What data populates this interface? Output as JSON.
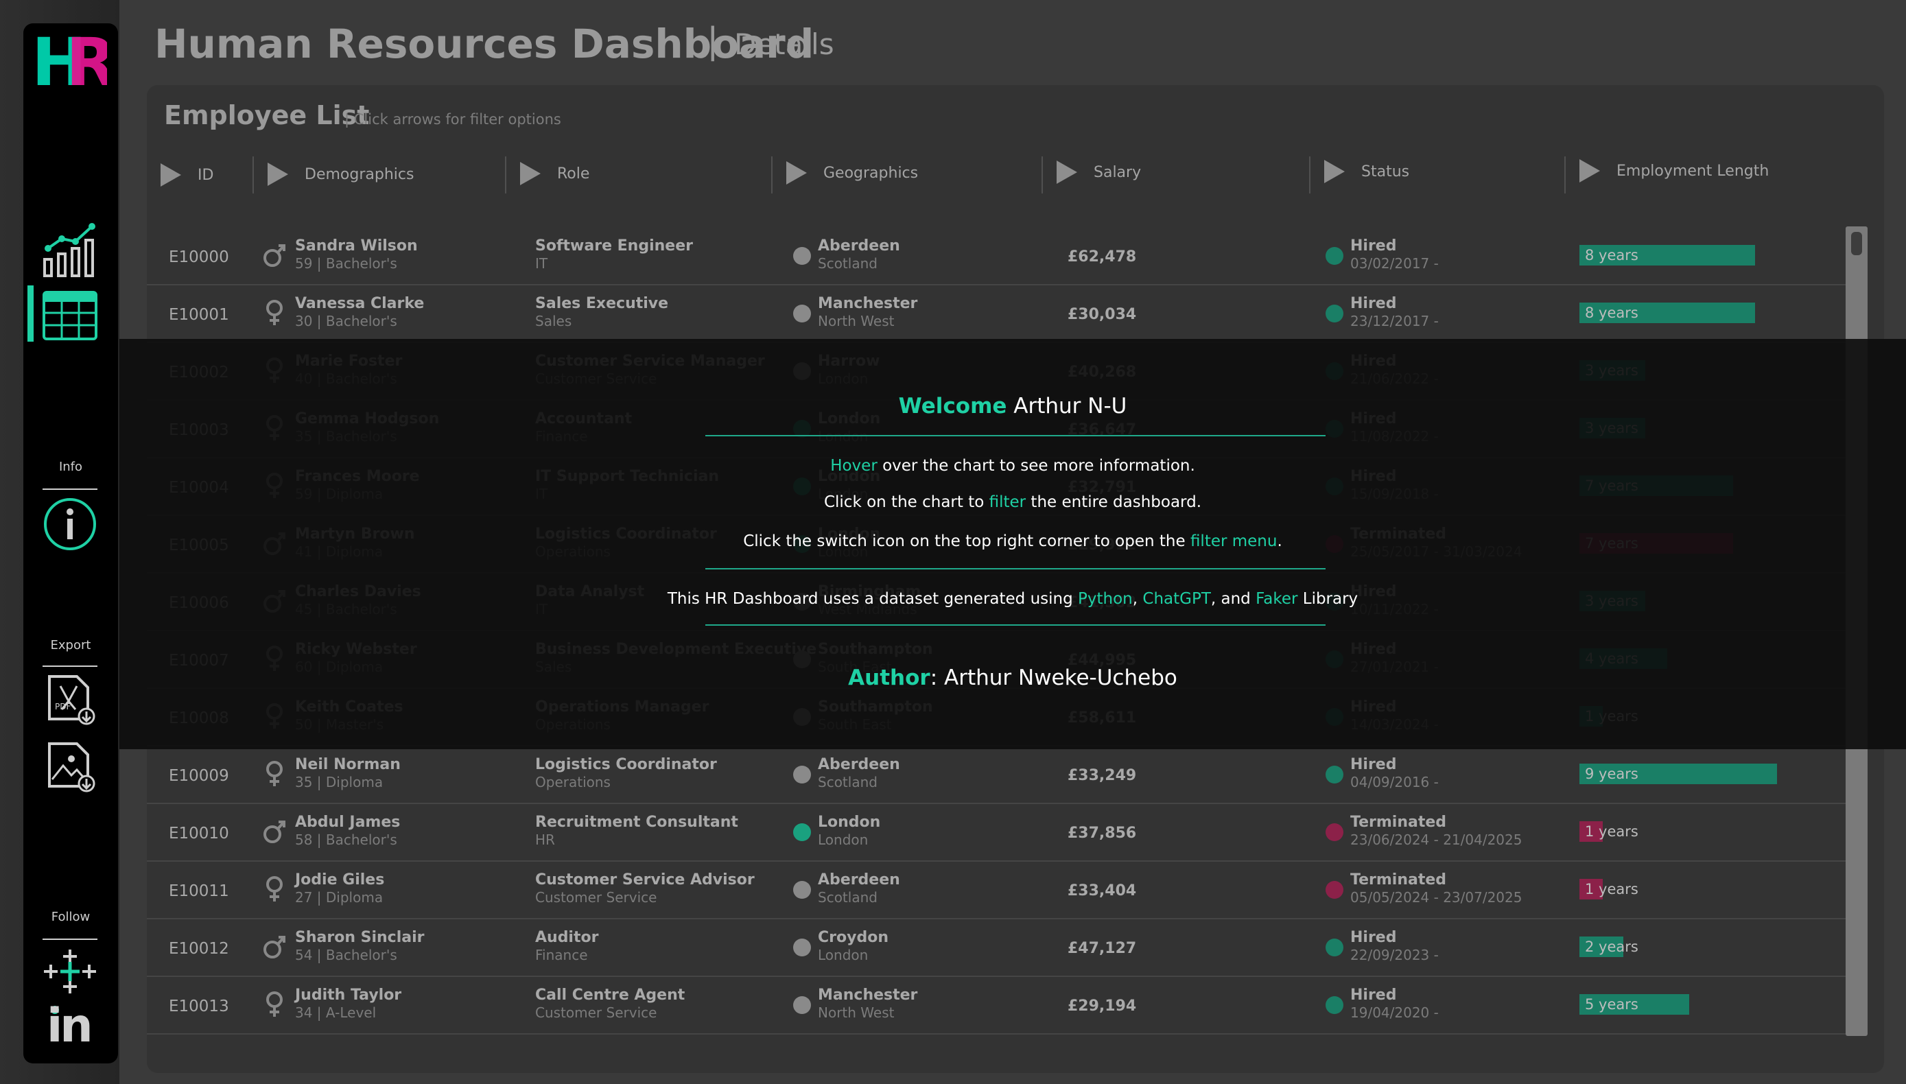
{
  "app": {
    "title": "Human Resources Dashboard",
    "separator": "|",
    "subtitle": "Details"
  },
  "sidebar": {
    "logo_letters": "HR",
    "info_label": "Info",
    "export_label": "Export",
    "follow_label": "Follow",
    "icons": [
      "line-chart-icon",
      "table-icon",
      "info-icon",
      "pdf-download-icon",
      "image-download-icon",
      "tableau-icon",
      "linkedin-icon"
    ],
    "pdf_badge": "PDF",
    "linkedin_text": "in"
  },
  "panel": {
    "title": "Employee List",
    "hint": "| Click arrows for filter options"
  },
  "columns": [
    "ID",
    "Demographics",
    "Role",
    "Geographics",
    "Salary",
    "Status",
    "Employment Length"
  ],
  "colors": {
    "accent": "#1fd1a5",
    "hired": "#1a7f66",
    "terminated": "#8c2149",
    "location_teal": "#1aa17f",
    "location_grey": "#8a8a8a",
    "logo_teal": "#00c9a7",
    "logo_pink": "#e0168f"
  },
  "rows": [
    {
      "id": "E10000",
      "name": "Sandra Wilson",
      "demo": "59 | Bachelor's",
      "gender": "male",
      "role": "Software Engineer",
      "dept": "IT",
      "city": "Aberdeen",
      "region": "Scotland",
      "loc": "grey",
      "salary": "£62,478",
      "status": "Hired",
      "dates": "03/02/2017 -",
      "tenure": "8 years",
      "years": 8
    },
    {
      "id": "E10001",
      "name": "Vanessa Clarke",
      "demo": "30 | Bachelor's",
      "gender": "female",
      "role": "Sales Executive",
      "dept": "Sales",
      "city": "Manchester",
      "region": "North West",
      "loc": "grey",
      "salary": "£30,034",
      "status": "Hired",
      "dates": "23/12/2017 -",
      "tenure": "8 years",
      "years": 8
    },
    {
      "id": "E10002",
      "name": "Marie Foster",
      "demo": "40 | Bachelor's",
      "gender": "female",
      "role": "Customer Service Manager",
      "dept": "Customer Service",
      "city": "Harrow",
      "region": "London",
      "loc": "grey",
      "salary": "£40,268",
      "status": "Hired",
      "dates": "21/06/2022 -",
      "tenure": "3 years",
      "years": 3
    },
    {
      "id": "E10003",
      "name": "Gemma Hodgson",
      "demo": "35 | Bachelor's",
      "gender": "female",
      "role": "Accountant",
      "dept": "Finance",
      "city": "London",
      "region": "London",
      "loc": "teal",
      "salary": "£36,647",
      "status": "Hired",
      "dates": "11/08/2022 -",
      "tenure": "3 years",
      "years": 3
    },
    {
      "id": "E10004",
      "name": "Frances Moore",
      "demo": "59 | Diploma",
      "gender": "female",
      "role": "IT Support Technician",
      "dept": "IT",
      "city": "London",
      "region": "London",
      "loc": "teal",
      "salary": "£32,791",
      "status": "Hired",
      "dates": "15/09/2018 -",
      "tenure": "7 years",
      "years": 7
    },
    {
      "id": "E10005",
      "name": "Martyn Brown",
      "demo": "41 | Diploma",
      "gender": "male",
      "role": "Logistics Coordinator",
      "dept": "Operations",
      "city": "London",
      "region": "London",
      "loc": "teal",
      "salary": "£29,912",
      "status": "Terminated",
      "dates": "25/05/2017 - 31/03/2024",
      "tenure": "7 years",
      "years": 7
    },
    {
      "id": "E10006",
      "name": "Charles Davies",
      "demo": "45 | Bachelor's",
      "gender": "male",
      "role": "Data Analyst",
      "dept": "IT",
      "city": "Birmingham",
      "region": "West Midlands",
      "loc": "grey",
      "salary": "£41,302",
      "status": "Hired",
      "dates": "10/11/2022 -",
      "tenure": "3 years",
      "years": 3
    },
    {
      "id": "E10007",
      "name": "Ricky Webster",
      "demo": "60 | Diploma",
      "gender": "female",
      "role": "Business Development Executive",
      "dept": "Sales",
      "city": "Southampton",
      "region": "South East",
      "loc": "grey",
      "salary": "£44,995",
      "status": "Hired",
      "dates": "27/01/2021 -",
      "tenure": "4 years",
      "years": 4
    },
    {
      "id": "E10008",
      "name": "Keith Coates",
      "demo": "50 | Master's",
      "gender": "female",
      "role": "Operations Manager",
      "dept": "Operations",
      "city": "Southampton",
      "region": "South East",
      "loc": "grey",
      "salary": "£58,611",
      "status": "Hired",
      "dates": "14/03/2024 -",
      "tenure": "1 years",
      "years": 1
    },
    {
      "id": "E10009",
      "name": "Neil Norman",
      "demo": "35 | Diploma",
      "gender": "female",
      "role": "Logistics Coordinator",
      "dept": "Operations",
      "city": "Aberdeen",
      "region": "Scotland",
      "loc": "grey",
      "salary": "£33,249",
      "status": "Hired",
      "dates": "04/09/2016 -",
      "tenure": "9 years",
      "years": 9
    },
    {
      "id": "E10010",
      "name": "Abdul James",
      "demo": "58 | Bachelor's",
      "gender": "male",
      "role": "Recruitment Consultant",
      "dept": "HR",
      "city": "London",
      "region": "London",
      "loc": "teal",
      "salary": "£37,856",
      "status": "Terminated",
      "dates": "23/06/2024 - 21/04/2025",
      "tenure": "1 years",
      "years": 1
    },
    {
      "id": "E10011",
      "name": "Jodie Giles",
      "demo": "27 | Diploma",
      "gender": "female",
      "role": "Customer Service Advisor",
      "dept": "Customer Service",
      "city": "Aberdeen",
      "region": "Scotland",
      "loc": "grey",
      "salary": "£33,404",
      "status": "Terminated",
      "dates": "05/05/2024 - 23/07/2025",
      "tenure": "1 years",
      "years": 1
    },
    {
      "id": "E10012",
      "name": "Sharon Sinclair",
      "demo": "54 | Bachelor's",
      "gender": "male",
      "role": "Auditor",
      "dept": "Finance",
      "city": "Croydon",
      "region": "London",
      "loc": "grey",
      "salary": "£47,127",
      "status": "Hired",
      "dates": "22/09/2023 -",
      "tenure": "2 years",
      "years": 2
    },
    {
      "id": "E10013",
      "name": "Judith Taylor",
      "demo": "34 | A-Level",
      "gender": "female",
      "role": "Call Centre Agent",
      "dept": "Customer Service",
      "city": "Manchester",
      "region": "North West",
      "loc": "grey",
      "salary": "£29,194",
      "status": "Hired",
      "dates": "19/04/2020 -",
      "tenure": "5 years",
      "years": 5
    }
  ],
  "overlay": {
    "welcome_word": "Welcome",
    "welcome_name": "Arthur N-U",
    "line1_accent": "Hover",
    "line1_rest": " over the chart to see more information.",
    "line2_pre": "Click on the chart to ",
    "line2_accent": "filter",
    "line2_post": " the entire dashboard.",
    "line3_pre": "Click the switch icon on the top right corner to open the ",
    "line3_accent": "filter menu",
    "line3_post": ".",
    "line4_pre": "This HR Dashboard uses a dataset generated using  ",
    "line4_python": "Python",
    "line4_comma": ", ",
    "line4_chatgpt": "ChatGPT",
    "line4_and": ", and ",
    "line4_faker": "Faker",
    "line4_post": " Library",
    "author_label": "Author",
    "author_colon": ":  ",
    "author_name": "Arthur Nweke-Uchebo"
  }
}
